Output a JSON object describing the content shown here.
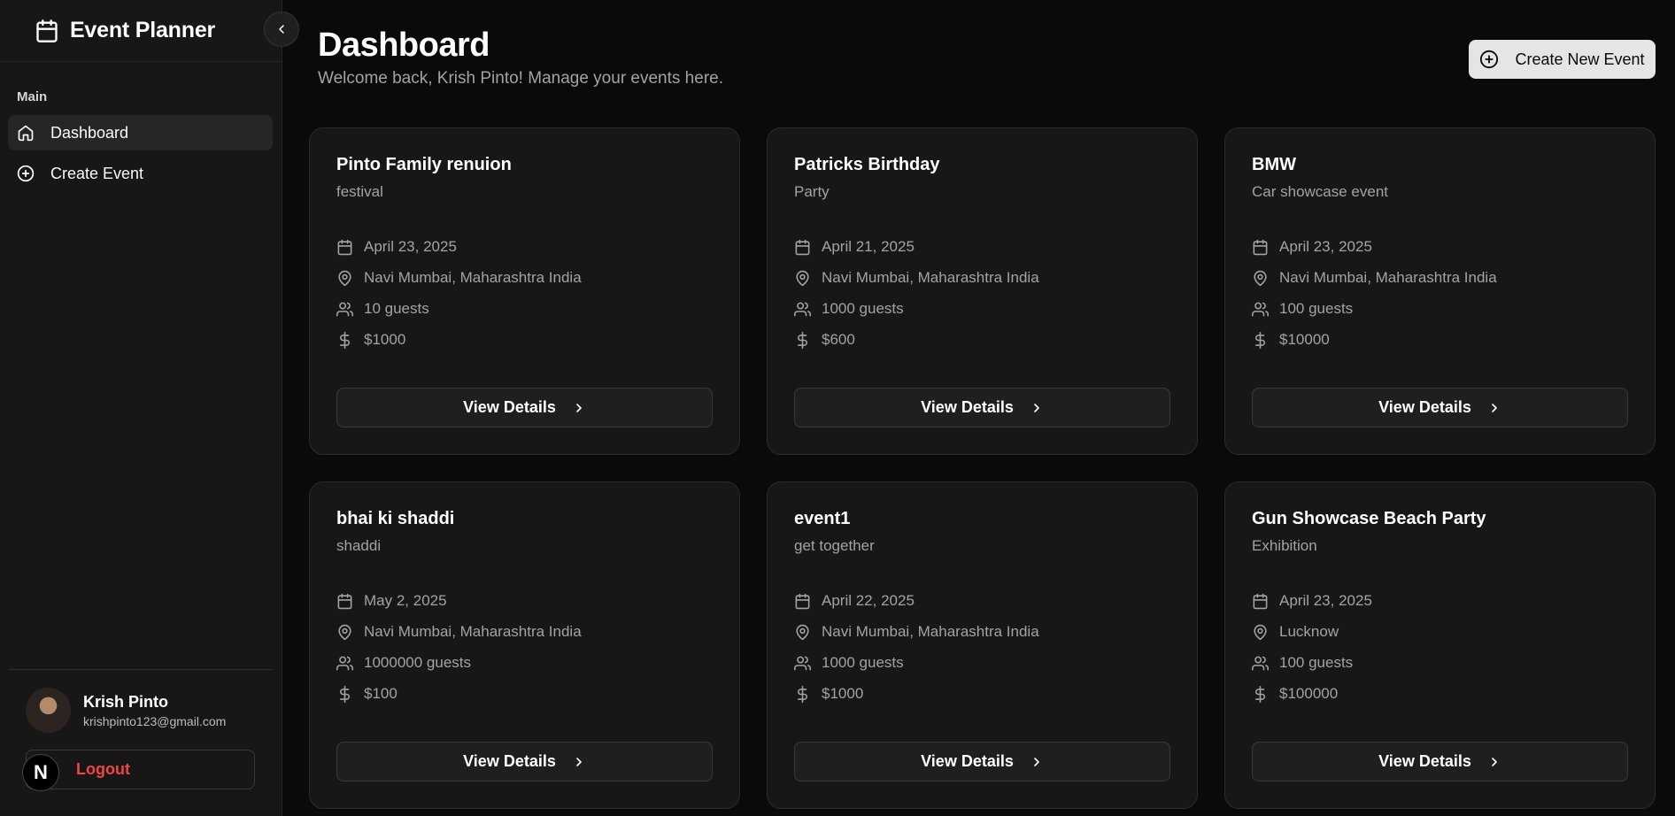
{
  "sidebar": {
    "brand_title": "Event Planner",
    "section_label": "Main",
    "items": [
      {
        "label": "Dashboard",
        "icon": "home-icon",
        "active": true
      },
      {
        "label": "Create Event",
        "icon": "plus-circle-icon",
        "active": false
      }
    ],
    "user": {
      "name": "Krish Pinto",
      "email": "krishpinto123@gmail.com"
    },
    "logout_label": "Logout",
    "badge_letter": "N"
  },
  "header": {
    "title": "Dashboard",
    "subtitle": "Welcome back, Krish Pinto! Manage your events here.",
    "create_button_label": "Create New Event"
  },
  "events": [
    {
      "title": "Pinto Family renuion",
      "type": "festival",
      "date": "April 23, 2025",
      "location": "Navi Mumbai, Maharashtra India",
      "guests": "10 guests",
      "budget": "$1000",
      "button_label": "View Details"
    },
    {
      "title": "Patricks Birthday",
      "type": "Party",
      "date": "April 21, 2025",
      "location": "Navi Mumbai, Maharashtra India",
      "guests": "1000 guests",
      "budget": "$600",
      "button_label": "View Details"
    },
    {
      "title": "BMW",
      "type": "Car showcase event",
      "date": "April 23, 2025",
      "location": "Navi Mumbai, Maharashtra India",
      "guests": "100 guests",
      "budget": "$10000",
      "button_label": "View Details"
    },
    {
      "title": "bhai ki shaddi",
      "type": "shaddi",
      "date": "May 2, 2025",
      "location": "Navi Mumbai, Maharashtra India",
      "guests": "1000000 guests",
      "budget": "$100",
      "button_label": "View Details"
    },
    {
      "title": "event1",
      "type": "get together",
      "date": "April 22, 2025",
      "location": "Navi Mumbai, Maharashtra India",
      "guests": "1000 guests",
      "budget": "$1000",
      "button_label": "View Details"
    },
    {
      "title": "Gun Showcase Beach Party",
      "type": "Exhibition",
      "date": "April 23, 2025",
      "location": "Lucknow",
      "guests": "100 guests",
      "budget": "$100000",
      "button_label": "View Details"
    }
  ]
}
